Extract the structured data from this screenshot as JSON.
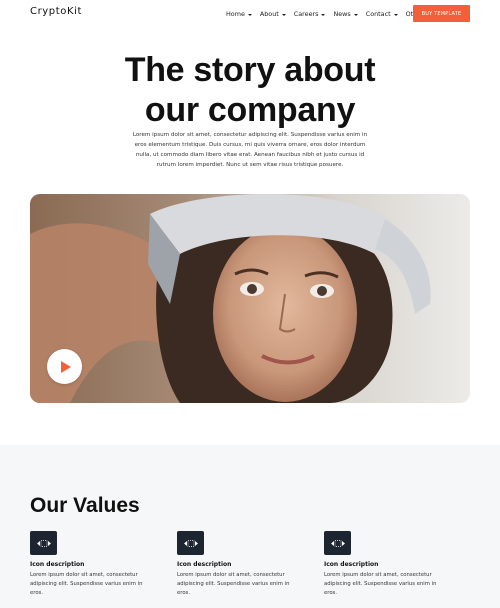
{
  "brand": {
    "logo": "CryptoKit",
    "accent": "#f2603a"
  },
  "nav": {
    "items": [
      {
        "label": "Home"
      },
      {
        "label": "About"
      },
      {
        "label": "Careers"
      },
      {
        "label": "News"
      },
      {
        "label": "Contact"
      },
      {
        "label": "Other"
      }
    ],
    "cta_label": "BUY TEMPLATE"
  },
  "hero": {
    "title_line1": "The story about",
    "title_line2": "our company",
    "subtitle": "Lorem ipsum dolor sit amet, consectetur adipiscing elit. Suspendisse varius enim in eros elementum tristique. Duis cursus, mi quis viverra ornare, eros dolor interdum nulla, ut commodo diam libero vitae erat. Aenean faucibus nibh et justo cursus id rutrum lorem imperdiet. Nunc ut sem vitae risus tristique posuere."
  },
  "media": {
    "play_icon": "play-icon"
  },
  "values": {
    "title": "Our Values",
    "items": [
      {
        "label": "Icon description",
        "description": "Lorem ipsum dolor sit amet, consectetur adipiscing elit. Suspendisse varius enim in eros."
      },
      {
        "label": "Icon description",
        "description": "Lorem ipsum dolor sit amet, consectetur adipiscing elit. Suspendisse varius enim in eros."
      },
      {
        "label": "Icon description",
        "description": "Lorem ipsum dolor sit amet, consectetur adipiscing elit. Suspendisse varius enim in eros."
      }
    ]
  }
}
